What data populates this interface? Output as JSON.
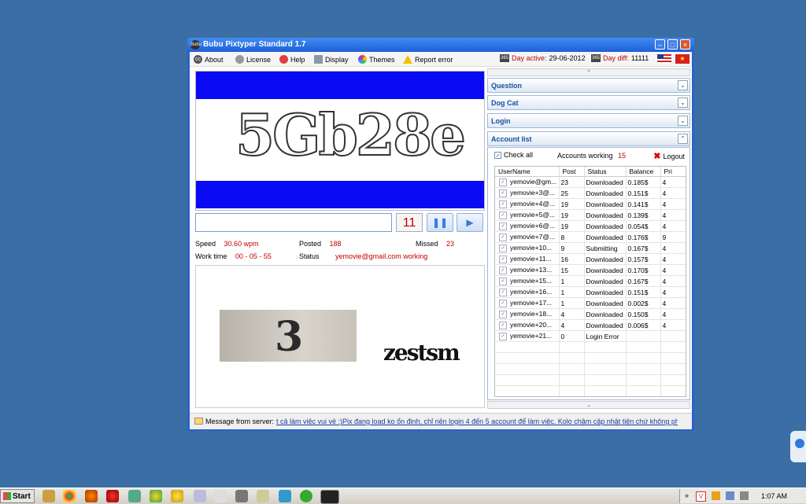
{
  "window": {
    "title": "Bubu Pixtyper Standard 1.7",
    "icon_label": "Bubu"
  },
  "menu": {
    "about": "About",
    "license": "License",
    "help": "Help",
    "display": "Display",
    "themes": "Themes",
    "report_error": "Report error"
  },
  "info": {
    "day_active_label": "Day active:",
    "day_active_value": "29-06-2012",
    "day_diff_label": "Day diff:",
    "day_diff_value": "11111"
  },
  "captcha": {
    "text": "5Gb28e",
    "input_value": "",
    "counter": "11"
  },
  "stats": {
    "speed_label": "Speed",
    "speed_value": "30.60 wpm",
    "posted_label": "Posted",
    "posted_value": "188",
    "missed_label": "Missed",
    "missed_value": "23",
    "worktime_label": "Work time",
    "worktime_value": "00 - 05 - 55",
    "status_label": "Status",
    "status_value": "yemovie@gmail.com working"
  },
  "preview": {
    "image1_text": "3",
    "image2_text": "zestsm"
  },
  "panels": {
    "question": "Question",
    "dogcat": "Dog Cat",
    "login": "Login",
    "account_list": "Account list"
  },
  "accounts": {
    "check_all": "Check all",
    "working_label": "Accounts working",
    "working_count": "15",
    "logout": "Logout",
    "columns": [
      "UserName",
      "Post",
      "Status",
      "Balance",
      "Pri"
    ],
    "rows": [
      [
        "yemovie@gm...",
        "23",
        "Downloaded",
        "0.185$",
        "4"
      ],
      [
        "yemovie+3@...",
        "25",
        "Downloaded",
        "0.151$",
        "4"
      ],
      [
        "yemovie+4@...",
        "19",
        "Downloaded",
        "0.141$",
        "4"
      ],
      [
        "yemovie+5@...",
        "19",
        "Downloaded",
        "0.139$",
        "4"
      ],
      [
        "yemovie+6@...",
        "19",
        "Downloaded",
        "0.054$",
        "4"
      ],
      [
        "yemovie+7@...",
        "8",
        "Downloaded",
        "0.176$",
        "9"
      ],
      [
        "yemovie+10...",
        "9",
        "Submitting",
        "0.167$",
        "4"
      ],
      [
        "yemovie+11...",
        "16",
        "Downloaded",
        "0.157$",
        "4"
      ],
      [
        "yemovie+13...",
        "15",
        "Downloaded",
        "0.170$",
        "4"
      ],
      [
        "yemovie+15...",
        "1",
        "Downloaded",
        "0.167$",
        "4"
      ],
      [
        "yemovie+16...",
        "1",
        "Downloaded",
        "0.151$",
        "4"
      ],
      [
        "yemovie+17...",
        "1",
        "Downloaded",
        "0.002$",
        "4"
      ],
      [
        "yemovie+18...",
        "4",
        "Downloaded",
        "0.150$",
        "4"
      ],
      [
        "yemovie+20...",
        "4",
        "Downloaded",
        "0.006$",
        "4"
      ],
      [
        "yemovie+21...",
        "0",
        "Login Error",
        "",
        ""
      ]
    ]
  },
  "statusbar": {
    "label": "Message from server:",
    "message": "t cả làm việc vui vẻ :)Pix đang load ko ổn định, chỉ nên login 4 đến 5 account để làm việc. Kolo chậm cập nhật tiện chứ không phải lỗi."
  },
  "taskbar": {
    "start": "Start",
    "clock": "1:07 AM"
  },
  "colors": {
    "desktop": "#3a6ea5",
    "captcha_band": "#0a0af5",
    "accent_red": "#c00000",
    "panel_title": "#1a4fa0"
  }
}
